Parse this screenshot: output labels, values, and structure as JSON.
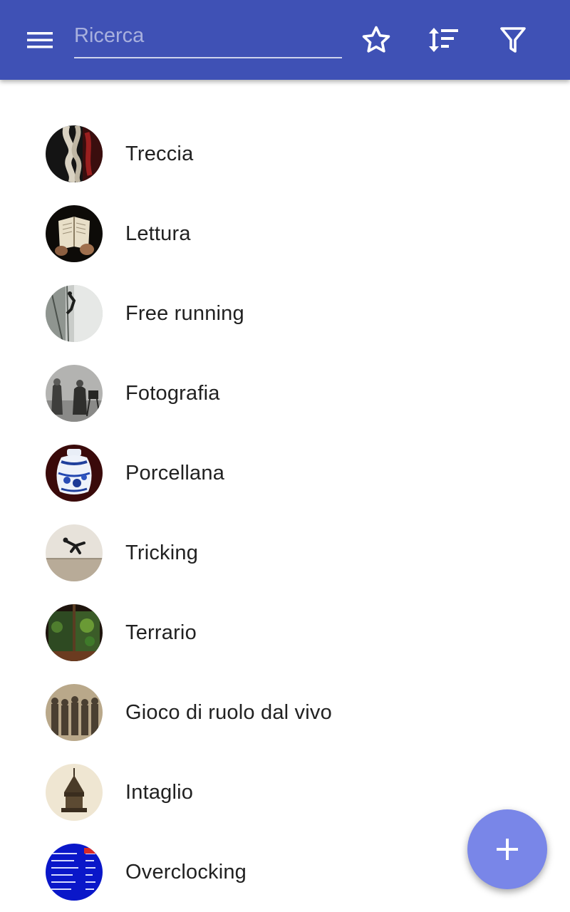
{
  "appbar": {
    "background": "#3f51b5",
    "menu_icon": "hamburger-menu-icon",
    "search": {
      "placeholder": "Ricerca",
      "value": ""
    },
    "actions": [
      {
        "icon": "star-outline-icon"
      },
      {
        "icon": "sort-icon"
      },
      {
        "icon": "filter-icon"
      }
    ]
  },
  "list": {
    "items": [
      {
        "label": "Treccia"
      },
      {
        "label": "Lettura"
      },
      {
        "label": "Free running"
      },
      {
        "label": "Fotografia"
      },
      {
        "label": "Porcellana"
      },
      {
        "label": "Tricking"
      },
      {
        "label": "Terrario"
      },
      {
        "label": "Gioco di ruolo dal vivo"
      },
      {
        "label": "Intaglio"
      },
      {
        "label": "Overclocking"
      }
    ]
  },
  "fab": {
    "icon": "plus-icon",
    "color": "#7986e8"
  }
}
